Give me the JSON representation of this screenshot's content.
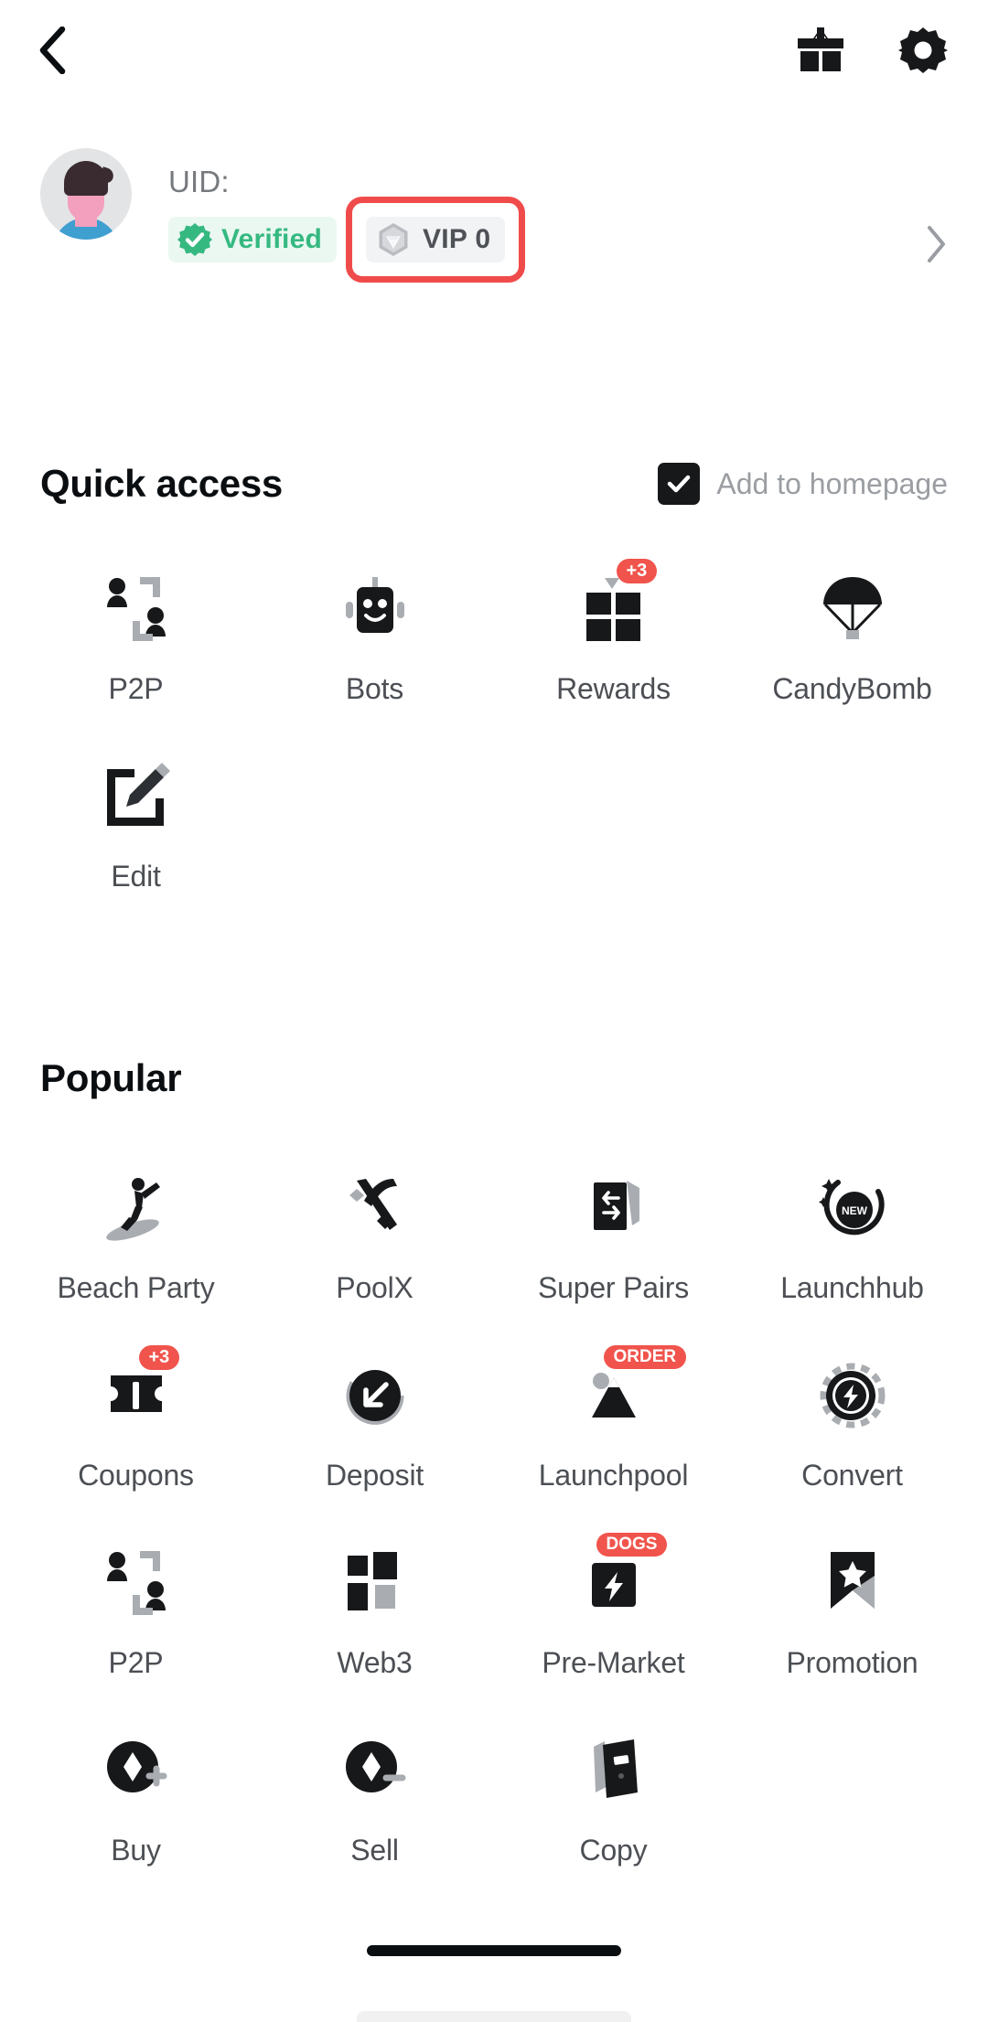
{
  "topbar": {
    "back_icon": "chevron-left-icon",
    "gift_icon": "gift-icon",
    "settings_icon": "gear-icon"
  },
  "profile": {
    "uid_label": "UID:",
    "uid_value": "",
    "verified_badge": {
      "label": "Verified",
      "icon": "verified-seal-icon",
      "text_color": "#35b981",
      "bg_color": "#eaf8f1"
    },
    "vip_badge": {
      "label": "VIP 0",
      "icon": "vip-diamond-icon",
      "text_color": "#4e5256",
      "bg_color": "#f2f3f5",
      "highlighted": true,
      "highlight_color": "#f04b4b"
    },
    "chevron_icon": "chevron-right-icon"
  },
  "quick_access": {
    "title": "Quick access",
    "add_to_homepage": {
      "label": "Add to homepage",
      "checked": true,
      "check_icon": "check-icon"
    },
    "items": [
      {
        "label": "P2P",
        "icon": "p2p-people-icon",
        "badge": null
      },
      {
        "label": "Bots",
        "icon": "robot-icon",
        "badge": null
      },
      {
        "label": "Rewards",
        "icon": "rewards-gift-grid-icon",
        "badge": "+3"
      },
      {
        "label": "CandyBomb",
        "icon": "parachute-icon",
        "badge": null
      },
      {
        "label": "Edit",
        "icon": "edit-pencil-square-icon",
        "badge": null
      }
    ]
  },
  "popular": {
    "title": "Popular",
    "items": [
      {
        "label": "Beach Party",
        "icon": "surfer-icon",
        "badge": null
      },
      {
        "label": "PoolX",
        "icon": "poolx-pickaxe-icon",
        "badge": null
      },
      {
        "label": "Super Pairs",
        "icon": "super-pairs-swap-icon",
        "badge": null
      },
      {
        "label": "Launchhub",
        "icon": "launchhub-new-circle-icon",
        "badge": null
      },
      {
        "label": "Coupons",
        "icon": "coupon-ticket-icon",
        "badge": "+3"
      },
      {
        "label": "Deposit",
        "icon": "deposit-arrow-down-left-icon",
        "badge": null
      },
      {
        "label": "Launchpool",
        "icon": "launchpool-mountain-icon",
        "badge": "ORDER"
      },
      {
        "label": "Convert",
        "icon": "convert-bolt-circle-icon",
        "badge": null
      },
      {
        "label": "P2P",
        "icon": "p2p-people-icon",
        "badge": null
      },
      {
        "label": "Web3",
        "icon": "web3-squares-icon",
        "badge": null
      },
      {
        "label": "Pre-Market",
        "icon": "pre-market-bolt-icon",
        "badge": "DOGS"
      },
      {
        "label": "Promotion",
        "icon": "promotion-bookmark-star-icon",
        "badge": null
      },
      {
        "label": "Buy",
        "icon": "buy-coin-plus-icon",
        "badge": null
      },
      {
        "label": "Sell",
        "icon": "sell-coin-minus-icon",
        "badge": null
      },
      {
        "label": "Copy",
        "icon": "copy-trading-icon",
        "badge": null
      }
    ]
  },
  "colors": {
    "accent_red": "#f0544c",
    "verified_green": "#35b981",
    "text_primary": "#0b0e11",
    "text_secondary": "#4c4f54",
    "text_muted": "#9a9da1"
  }
}
